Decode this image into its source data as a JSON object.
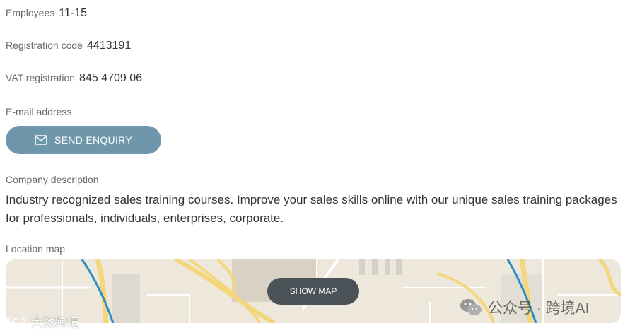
{
  "details": {
    "employees_label": "Employees",
    "employees_value": "11-15",
    "registration_label": "Registration code",
    "registration_value": "4413191",
    "vat_label": "VAT registration",
    "vat_value": "845 4709 06",
    "email_label": "E-mail address"
  },
  "enquiry_button": {
    "label": "SEND ENQUIRY",
    "icon": "envelope-icon",
    "color": "#6f97ab"
  },
  "description": {
    "label": "Company description",
    "text": "Industry recognized sales training courses. Improve your sales skills online with our unique sales training packages for professionals, individuals, enterprises, corporate."
  },
  "map": {
    "label": "Location map",
    "button_label": "SHOW MAP"
  },
  "watermarks": {
    "left_text": "大数跨境",
    "right_text": "公众号 · 跨境AI"
  }
}
